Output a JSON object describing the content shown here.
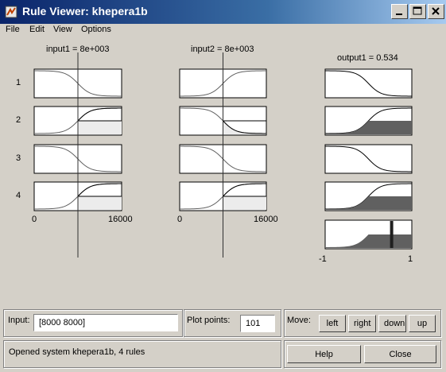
{
  "window": {
    "title": "Rule Viewer: khepera1b"
  },
  "menu": [
    "File",
    "Edit",
    "View",
    "Options"
  ],
  "columns": [
    {
      "label": "input1 = 8e+003",
      "axis_min": "0",
      "axis_max": "16000"
    },
    {
      "label": "input2 = 8e+003",
      "axis_min": "0",
      "axis_max": "16000"
    },
    {
      "label": "output1 = 0.534",
      "axis_min": "-1",
      "axis_max": "1"
    }
  ],
  "rules": [
    "1",
    "2",
    "3",
    "4"
  ],
  "chart_data": {
    "type": "line",
    "title": "",
    "input_range": [
      0,
      16000
    ],
    "output_range": [
      -1,
      1
    ],
    "inputs": {
      "input1": 8000,
      "input2": 8000
    },
    "output": {
      "output1": 0.534
    },
    "membership_functions": {
      "input1": [
        "decreasing",
        "increasing",
        "decreasing",
        "increasing"
      ],
      "input2": [
        "increasing",
        "decreasing",
        "decreasing",
        "increasing"
      ],
      "output1": [
        "decreasing",
        "increasing",
        "decreasing",
        "increasing"
      ]
    },
    "firing_levels": [
      0.0,
      0.5,
      0.0,
      0.5
    ]
  },
  "controls": {
    "input_label": "Input:",
    "input_value": "[8000 8000]",
    "plot_points_label": "Plot points:",
    "plot_points_value": "101",
    "move_label": "Move:",
    "move_buttons": [
      "left",
      "right",
      "down",
      "up"
    ],
    "status": "Opened system khepera1b, 4 rules",
    "help": "Help",
    "close": "Close"
  }
}
